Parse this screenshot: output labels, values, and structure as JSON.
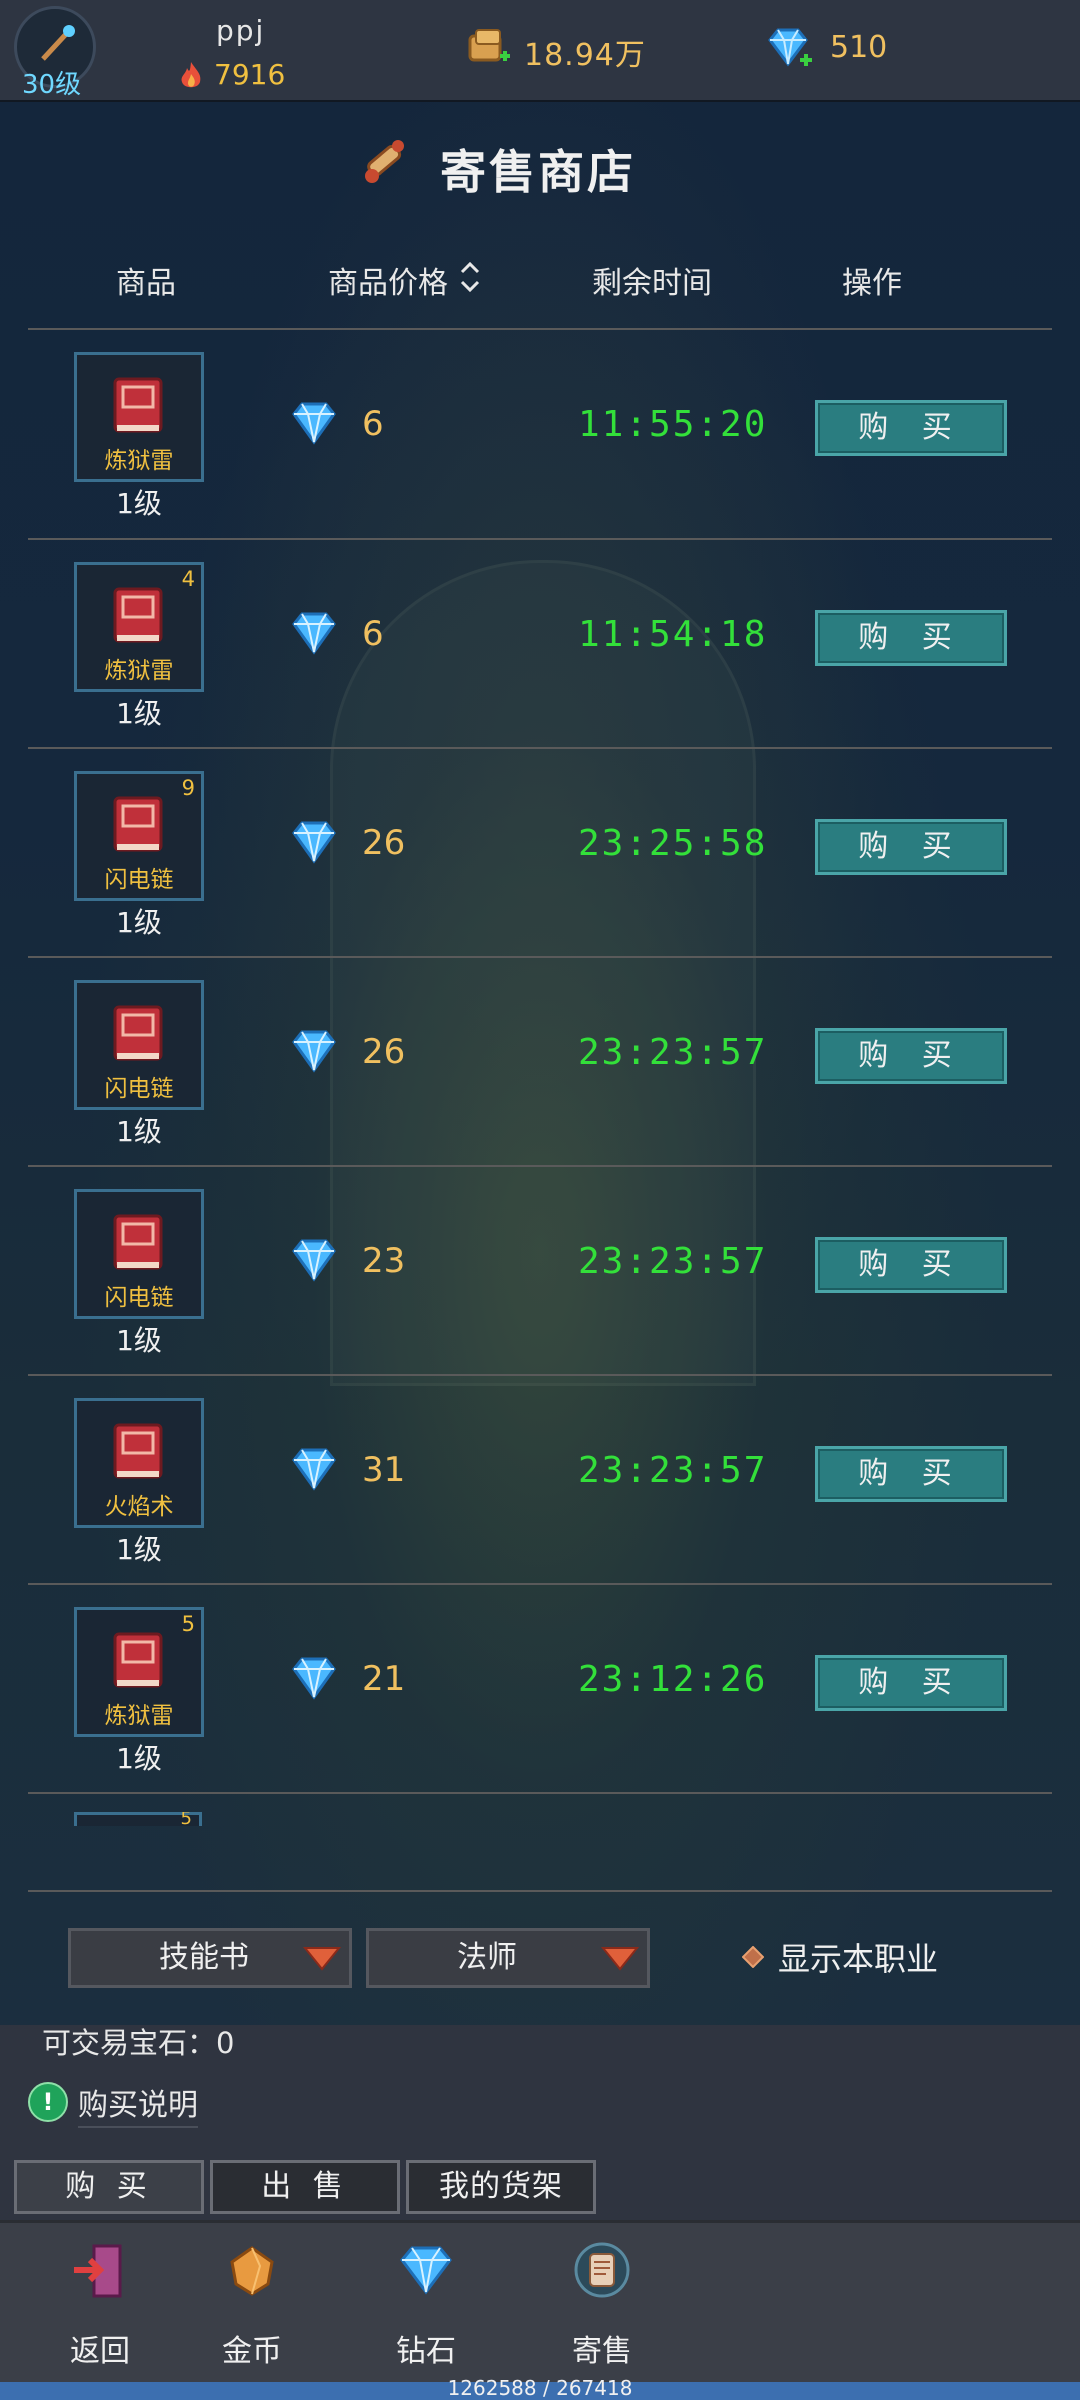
{
  "player": {
    "name": "ppj",
    "level": "30级",
    "power": "7916",
    "gold": "18.94万",
    "diamonds": "510"
  },
  "shop": {
    "title": "寄售商店"
  },
  "table": {
    "headers": {
      "item": "商品",
      "price": "商品价格",
      "time": "剩余时间",
      "action": "操作"
    },
    "rows": [
      {
        "name": "炼狱雷",
        "stack": "",
        "level": "1级",
        "price": "6",
        "time": "11:55:20",
        "action": "购 买"
      },
      {
        "name": "炼狱雷",
        "stack": "4",
        "level": "1级",
        "price": "6",
        "time": "11:54:18",
        "action": "购 买"
      },
      {
        "name": "闪电链",
        "stack": "9",
        "level": "1级",
        "price": "26",
        "time": "23:25:58",
        "action": "购 买"
      },
      {
        "name": "闪电链",
        "stack": "",
        "level": "1级",
        "price": "26",
        "time": "23:23:57",
        "action": "购 买"
      },
      {
        "name": "闪电链",
        "stack": "",
        "level": "1级",
        "price": "23",
        "time": "23:23:57",
        "action": "购 买"
      },
      {
        "name": "火焰术",
        "stack": "",
        "level": "1级",
        "price": "31",
        "time": "23:23:57",
        "action": "购 买"
      },
      {
        "name": "炼狱雷",
        "stack": "5",
        "level": "1级",
        "price": "21",
        "time": "23:12:26",
        "action": "购 买"
      }
    ],
    "partial_stack": "5"
  },
  "filters": {
    "category": "技能书",
    "profession": "法师",
    "show_own_label": "显示本职业"
  },
  "info": {
    "tradable": "可交易宝石：0",
    "buy_info": "购买说明"
  },
  "tabs": [
    "购 买",
    "出 售",
    "我的货架"
  ],
  "nav": [
    "返回",
    "金币",
    "钻石",
    "寄售"
  ],
  "status": {
    "coords": "1262588 / 267418"
  },
  "colors": {
    "timer": "#33e03a",
    "price": "#f0c060",
    "button": "#2a7d80"
  }
}
